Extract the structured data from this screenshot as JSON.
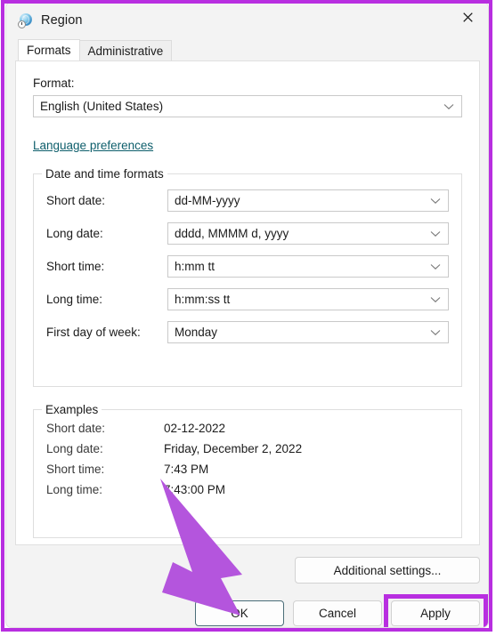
{
  "window": {
    "title": "Region",
    "icon": "region-globe-clock-icon",
    "close_label": "✕"
  },
  "tabs": [
    {
      "label": "Formats",
      "active": true
    },
    {
      "label": "Administrative",
      "active": false
    }
  ],
  "format_section": {
    "label": "Format:",
    "value": "English (United States)",
    "link": "Language preferences"
  },
  "datetime_group": {
    "legend": "Date and time formats",
    "rows": [
      {
        "label": "Short date:",
        "value": "dd-MM-yyyy"
      },
      {
        "label": "Long date:",
        "value": "dddd, MMMM d, yyyy"
      },
      {
        "label": "Short time:",
        "value": "h:mm tt"
      },
      {
        "label": "Long time:",
        "value": "h:mm:ss tt"
      },
      {
        "label": "First day of week:",
        "value": "Monday"
      }
    ]
  },
  "examples_group": {
    "legend": "Examples",
    "rows": [
      {
        "label": "Short date:",
        "value": "02-12-2022"
      },
      {
        "label": "Long date:",
        "value": "Friday, December 2, 2022"
      },
      {
        "label": "Short time:",
        "value": "7:43 PM"
      },
      {
        "label": "Long time:",
        "value": "7:43:00 PM"
      }
    ]
  },
  "buttons": {
    "additional_settings": "Additional settings...",
    "ok": "OK",
    "cancel": "Cancel",
    "apply": "Apply"
  },
  "annotations": {
    "accent_color": "#b82ee0",
    "arrow_color": "#b455dd",
    "arrow_target": "ok-button",
    "highlight_target": "apply-button"
  },
  "colors": {
    "window_bg": "#f3f3f3",
    "page_bg": "#ffffff",
    "link": "#0d5e6b",
    "default_button_border": "#4a6d78"
  }
}
